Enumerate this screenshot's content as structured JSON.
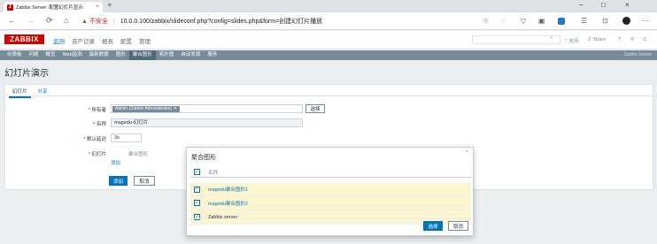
{
  "browser": {
    "tab_title": "Zabbix Server: 配置幻灯片显示",
    "tab_close": "×",
    "new_tab": "+",
    "minimize": "–",
    "maximize": "□",
    "close": "×",
    "back": "←",
    "forward": "→",
    "reload": "⟳",
    "home": "⌂",
    "warn_icon": "▲",
    "insecure_label": "不安全",
    "separator": "|",
    "url": "10.0.0.100/zabbix/slideconf.php?config=slides.php&form=创建幻灯片播放"
  },
  "header": {
    "logo": "ZABBIX",
    "nav": [
      "监测",
      "资产记录",
      "报表",
      "配置",
      "管理"
    ],
    "active_nav": "监测",
    "support_label": "支持",
    "share_label": "Share",
    "help": "?",
    "user": "⚲",
    "logout": "⏻"
  },
  "subnav": {
    "items": [
      "仪表板",
      "问题",
      "概览",
      "Web监测",
      "最新数据",
      "图形",
      "聚合图形",
      "拓扑图",
      "自动发现",
      "服务"
    ],
    "active": "聚合图形",
    "server_name": "Zabbix Server"
  },
  "page": {
    "title": "幻灯片演示"
  },
  "form": {
    "tabs": [
      "幻灯片",
      "分享"
    ],
    "active_tab": "幻灯片",
    "owner_label": "所有者",
    "owner_value": "Admin (Zabbix Administrator)",
    "owner_remove": "✕",
    "select_label": "选择",
    "name_label": "名称",
    "name_value": "magedu-幻灯片",
    "delay_label": "默认延迟",
    "delay_value": "3s",
    "slides_label": "幻灯片",
    "slides_col": "聚合图形",
    "add_link": "添加",
    "add_button": "添加",
    "cancel_button": "取消",
    "required_mark": "*"
  },
  "dialog": {
    "title": "聚合图形",
    "close": "×",
    "column_name": "名称",
    "rows": [
      "magedu聚合图形1",
      "magedu聚合图形2",
      "Zabbix server"
    ],
    "select_button": "选择",
    "cancel_button": "取消",
    "check_mark": "✓"
  }
}
